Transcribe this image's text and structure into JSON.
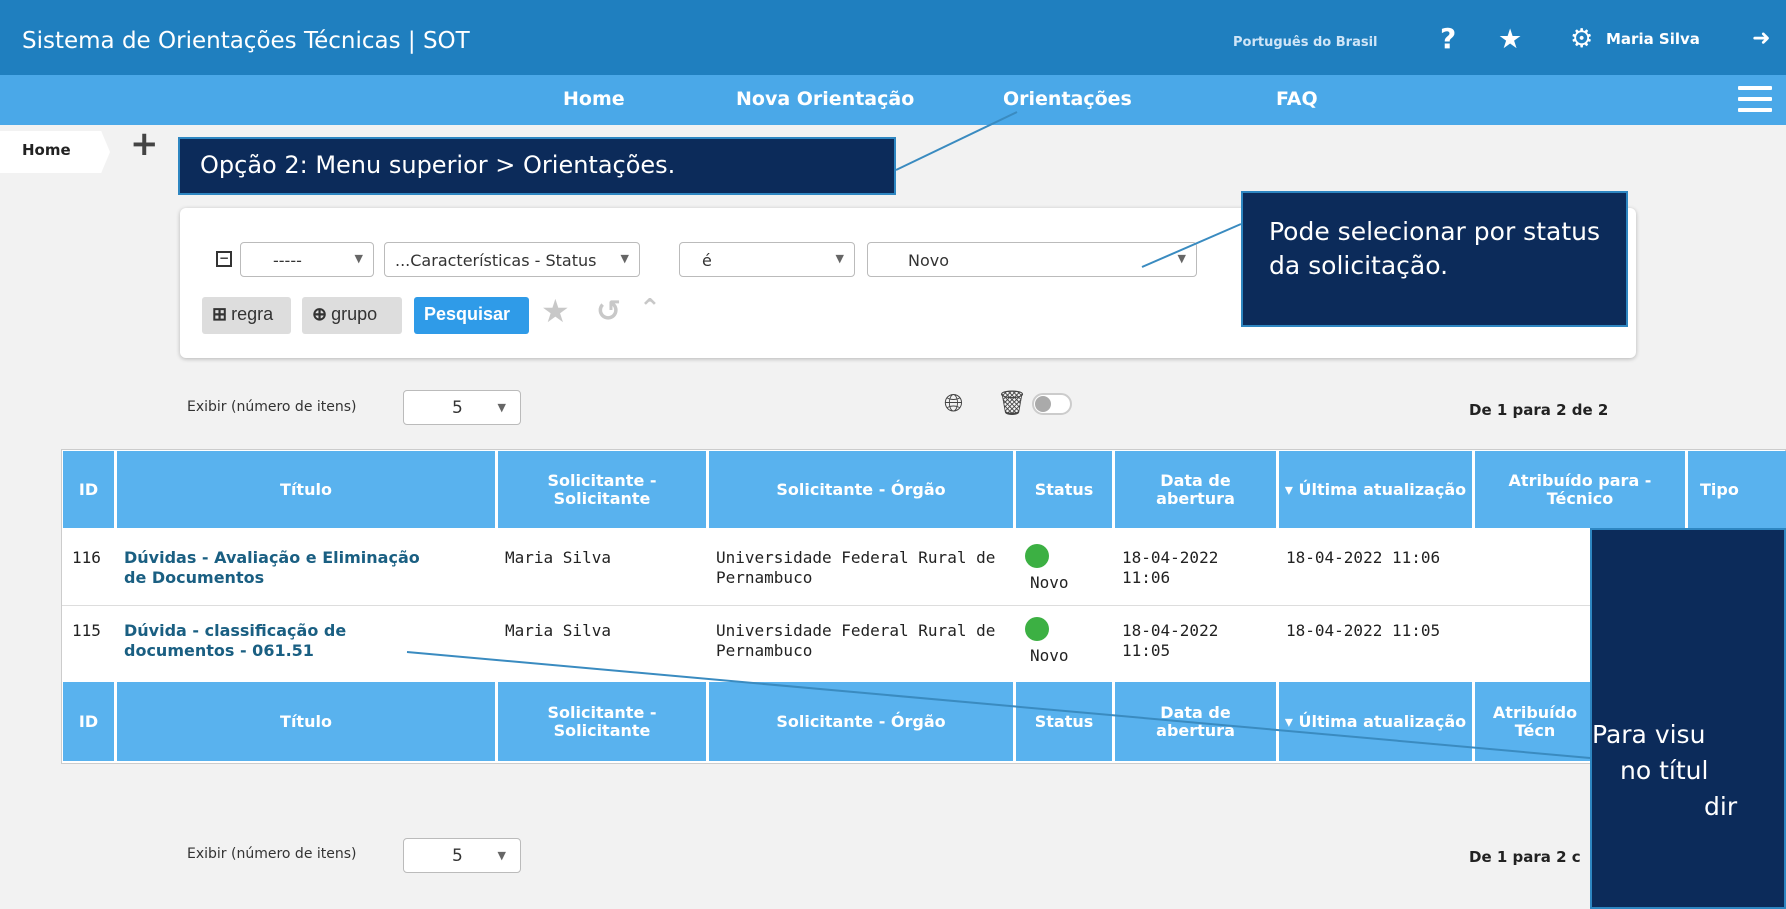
{
  "header": {
    "app_title": "Sistema de Orientações Técnicas | SOT",
    "language": "Português do Brasil",
    "user_name": "Maria Silva"
  },
  "nav": {
    "items": [
      "Home",
      "Nova Orientação",
      "Orientações",
      "FAQ"
    ]
  },
  "breadcrumb": {
    "home": "Home",
    "add": "+"
  },
  "callouts": {
    "menu_option": "Opção 2: Menu superior > Orientações.",
    "status_filter": "Pode selecionar por status da solicitação.",
    "title_click_l1": "Para visu",
    "title_click_l2": "no títul",
    "title_click_l3": "dir"
  },
  "filter": {
    "sel1": "-----",
    "sel2": "...Características - Status",
    "sel3": "é",
    "sel4": "Novo",
    "btn_rule": "regra",
    "btn_group": "grupo",
    "btn_search": "Pesquisar"
  },
  "listing": {
    "show_label": "Exibir (número de itens)",
    "show_value": "5",
    "pager_top": "De 1 para 2 de 2",
    "pager_bottom": "De 1 para 2 c"
  },
  "table": {
    "headers": [
      "ID",
      "Título",
      "Solicitante - Solicitante",
      "Solicitante - Órgão",
      "Status",
      "Data de abertura",
      "▾ Última atualização",
      "Atribuído para - Técnico",
      "Tipo"
    ],
    "footer_headers": [
      "ID",
      "Título",
      "Solicitante - Solicitante",
      "Solicitante - Órgão",
      "Status",
      "Data de abertura",
      "▾ Última atualização",
      "Atribuído Técn"
    ],
    "rows": [
      {
        "id": "116",
        "title_l1": "Dúvidas - Avaliação e Eliminação",
        "title_l2": "de Documentos",
        "requester": "Maria Silva",
        "org_l1": "Universidade Federal Rural de",
        "org_l2": "Pernambuco",
        "status": "Novo",
        "opened_l1": "18-04-2022",
        "opened_l2": "11:06",
        "updated": "18-04-2022 11:06"
      },
      {
        "id": "115",
        "title_l1": "Dúvida - classificação de",
        "title_l2": "documentos - 061.51",
        "requester": "Maria Silva",
        "org_l1": "Universidade Federal Rural de",
        "org_l2": "Pernambuco",
        "status": "Novo",
        "opened_l1": "18-04-2022",
        "opened_l2": "11:05",
        "updated": "18-04-2022 11:05"
      }
    ]
  },
  "colors": {
    "topbar": "#1f7fbf",
    "navbar": "#4aa8e8",
    "callout": "#0c2b5a",
    "status_new": "#3cb043",
    "th": "#59b2ee"
  }
}
